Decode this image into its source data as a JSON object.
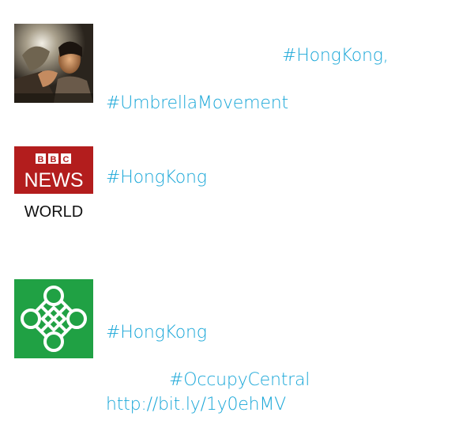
{
  "tweets": [
    {
      "avatar": {
        "icon": "protest-photo-avatar"
      },
      "links": [
        "#HongKong,",
        "#UmbrellaMovement"
      ]
    },
    {
      "avatar": {
        "icon": "bbc-news-world-logo",
        "logo_top": "BBC",
        "logo_middle": "NEWS",
        "logo_bottom": "WORLD"
      },
      "links": [
        "#HongKong"
      ]
    },
    {
      "avatar": {
        "icon": "green-knot-logo"
      },
      "links": [
        "#HongKong",
        "#OccupyCentral",
        "http://bit.ly/1y0ehMV"
      ]
    }
  ],
  "colors": {
    "link": "#1aa7d8",
    "bbc_red": "#b31d1d",
    "knot_green": "#20a144"
  }
}
